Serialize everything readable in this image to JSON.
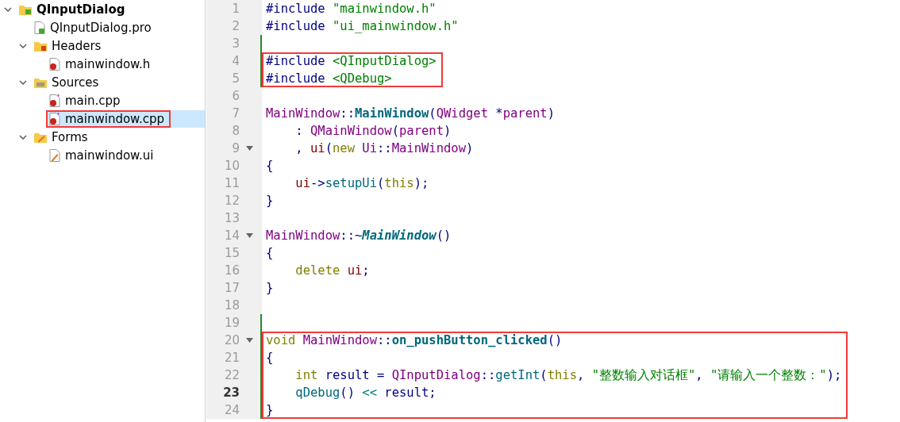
{
  "project_tree": [
    {
      "label": "QInputDialog",
      "kind": "project",
      "expanded": true,
      "selected": false,
      "highlighted": false,
      "children": [
        {
          "label": "QInputDialog.pro",
          "kind": "pro-file",
          "selected": false,
          "highlighted": false
        },
        {
          "label": "Headers",
          "kind": "headers-folder",
          "expanded": true,
          "selected": false,
          "highlighted": false,
          "children": [
            {
              "label": "mainwindow.h",
              "kind": "header-file",
              "selected": false,
              "highlighted": false
            }
          ]
        },
        {
          "label": "Sources",
          "kind": "sources-folder",
          "expanded": true,
          "selected": false,
          "highlighted": false,
          "children": [
            {
              "label": "main.cpp",
              "kind": "source-file",
              "selected": false,
              "highlighted": false
            },
            {
              "label": "mainwindow.cpp",
              "kind": "source-file",
              "selected": true,
              "highlighted": true
            }
          ]
        },
        {
          "label": "Forms",
          "kind": "forms-folder",
          "expanded": true,
          "selected": false,
          "highlighted": false,
          "children": [
            {
              "label": "mainwindow.ui",
              "kind": "form-file",
              "selected": false,
              "highlighted": false
            }
          ]
        }
      ]
    }
  ],
  "editor": {
    "segments": [
      {
        "highlighted": false,
        "lines": [
          {
            "number": "1",
            "changed": false,
            "current": false,
            "foldable": false,
            "tokens": [
              {
                "t": "#include ",
                "kind": "pre"
              },
              {
                "t": "\"mainwindow.h\"",
                "kind": "str"
              }
            ]
          },
          {
            "number": "2",
            "changed": false,
            "current": false,
            "foldable": false,
            "tokens": [
              {
                "t": "#include ",
                "kind": "pre"
              },
              {
                "t": "\"ui_mainwindow.h\"",
                "kind": "str"
              }
            ]
          },
          {
            "number": "3",
            "changed": true,
            "current": false,
            "foldable": false
          }
        ]
      },
      {
        "highlighted": true,
        "lines": [
          {
            "number": "4",
            "changed": true,
            "current": false,
            "foldable": false,
            "tokens": [
              {
                "t": "#include ",
                "kind": "pre"
              },
              {
                "t": "<QInputDialog>",
                "kind": "str"
              }
            ]
          },
          {
            "number": "5",
            "changed": true,
            "current": false,
            "foldable": false,
            "tokens": [
              {
                "t": "#include ",
                "kind": "pre"
              },
              {
                "t": "<QDebug>",
                "kind": "str"
              }
            ]
          }
        ]
      },
      {
        "highlighted": false,
        "lines": [
          {
            "number": "6",
            "changed": false,
            "current": false,
            "foldable": false
          },
          {
            "number": "7",
            "changed": false,
            "current": false,
            "foldable": false,
            "tokens": [
              {
                "t": "MainWindow",
                "kind": "type"
              },
              {
                "t": "::",
                "kind": "plain"
              },
              {
                "t": "MainWindow",
                "kind": "fn"
              },
              {
                "t": "(",
                "kind": "plain"
              },
              {
                "t": "QWidget",
                "kind": "type"
              },
              {
                "t": " *",
                "kind": "plain"
              },
              {
                "t": "parent",
                "kind": "type"
              },
              {
                "t": ")",
                "kind": "plain"
              }
            ]
          },
          {
            "number": "8",
            "changed": false,
            "current": false,
            "foldable": false,
            "tokens": [
              {
                "t": "    : ",
                "kind": "plain"
              },
              {
                "t": "QMainWindow",
                "kind": "type"
              },
              {
                "t": "(",
                "kind": "plain"
              },
              {
                "t": "parent",
                "kind": "type"
              },
              {
                "t": ")",
                "kind": "plain"
              }
            ]
          },
          {
            "number": "9",
            "changed": false,
            "current": false,
            "foldable": true,
            "tokens": [
              {
                "t": "    , ",
                "kind": "plain"
              },
              {
                "t": "ui",
                "kind": "member"
              },
              {
                "t": "(",
                "kind": "plain"
              },
              {
                "t": "new ",
                "kind": "kw"
              },
              {
                "t": "Ui",
                "kind": "type"
              },
              {
                "t": "::",
                "kind": "plain"
              },
              {
                "t": "MainWindow",
                "kind": "type"
              },
              {
                "t": ")",
                "kind": "plain"
              }
            ]
          },
          {
            "number": "10",
            "changed": false,
            "current": false,
            "foldable": false,
            "tokens": [
              {
                "t": "{",
                "kind": "plain"
              }
            ]
          },
          {
            "number": "11",
            "changed": false,
            "current": false,
            "foldable": false,
            "tokens": [
              {
                "t": "    ui",
                "kind": "member"
              },
              {
                "t": "->",
                "kind": "plain"
              },
              {
                "t": "setupUi",
                "kind": "call"
              },
              {
                "t": "(",
                "kind": "plain"
              },
              {
                "t": "this",
                "kind": "kw"
              },
              {
                "t": ");",
                "kind": "plain"
              }
            ]
          },
          {
            "number": "12",
            "changed": false,
            "current": false,
            "foldable": false,
            "tokens": [
              {
                "t": "}",
                "kind": "plain"
              }
            ]
          },
          {
            "number": "13",
            "changed": false,
            "current": false,
            "foldable": false
          },
          {
            "number": "14",
            "changed": false,
            "current": false,
            "foldable": true,
            "tokens": [
              {
                "t": "MainWindow",
                "kind": "type"
              },
              {
                "t": "::~",
                "kind": "plain"
              },
              {
                "t": "MainWindow",
                "kind": "fn-italic"
              },
              {
                "t": "()",
                "kind": "plain"
              }
            ]
          },
          {
            "number": "15",
            "changed": false,
            "current": false,
            "foldable": false,
            "tokens": [
              {
                "t": "{",
                "kind": "plain"
              }
            ]
          },
          {
            "number": "16",
            "changed": false,
            "current": false,
            "foldable": false,
            "tokens": [
              {
                "t": "    delete ",
                "kind": "kw"
              },
              {
                "t": "ui",
                "kind": "member"
              },
              {
                "t": ";",
                "kind": "plain"
              }
            ]
          },
          {
            "number": "17",
            "changed": false,
            "current": false,
            "foldable": false,
            "tokens": [
              {
                "t": "}",
                "kind": "plain"
              }
            ]
          },
          {
            "number": "18",
            "changed": false,
            "current": false,
            "foldable": false
          },
          {
            "number": "19",
            "changed": true,
            "current": false,
            "foldable": false
          }
        ]
      },
      {
        "highlighted": true,
        "lines": [
          {
            "number": "20",
            "changed": true,
            "current": false,
            "foldable": true,
            "tokens": [
              {
                "t": "void ",
                "kind": "kw"
              },
              {
                "t": "MainWindow",
                "kind": "type"
              },
              {
                "t": "::",
                "kind": "plain"
              },
              {
                "t": "on_pushButton_clicked",
                "kind": "fn"
              },
              {
                "t": "()",
                "kind": "plain"
              }
            ]
          },
          {
            "number": "21",
            "changed": true,
            "current": false,
            "foldable": false,
            "tokens": [
              {
                "t": "{",
                "kind": "plain"
              }
            ]
          },
          {
            "number": "22",
            "changed": true,
            "current": false,
            "foldable": false,
            "tokens": [
              {
                "t": "    int ",
                "kind": "kw"
              },
              {
                "t": "result = ",
                "kind": "plain"
              },
              {
                "t": "QInputDialog",
                "kind": "type"
              },
              {
                "t": "::",
                "kind": "plain"
              },
              {
                "t": "getInt",
                "kind": "call"
              },
              {
                "t": "(",
                "kind": "plain"
              },
              {
                "t": "this",
                "kind": "kw"
              },
              {
                "t": ", ",
                "kind": "plain"
              },
              {
                "t": "\"整数输入对话框\"",
                "kind": "str"
              },
              {
                "t": ", ",
                "kind": "plain"
              },
              {
                "t": "\"请输入一个整数：\"",
                "kind": "str"
              },
              {
                "t": ");",
                "kind": "plain"
              }
            ]
          },
          {
            "number": "23",
            "changed": true,
            "current": true,
            "foldable": false,
            "tokens": [
              {
                "t": "    qDebug",
                "kind": "call"
              },
              {
                "t": "() ",
                "kind": "plain"
              },
              {
                "t": "<<",
                "kind": "op"
              },
              {
                "t": " result;",
                "kind": "plain"
              }
            ]
          },
          {
            "number": "24",
            "changed": true,
            "current": false,
            "foldable": false,
            "tokens": [
              {
                "t": "}",
                "kind": "plain"
              }
            ]
          }
        ]
      }
    ]
  }
}
